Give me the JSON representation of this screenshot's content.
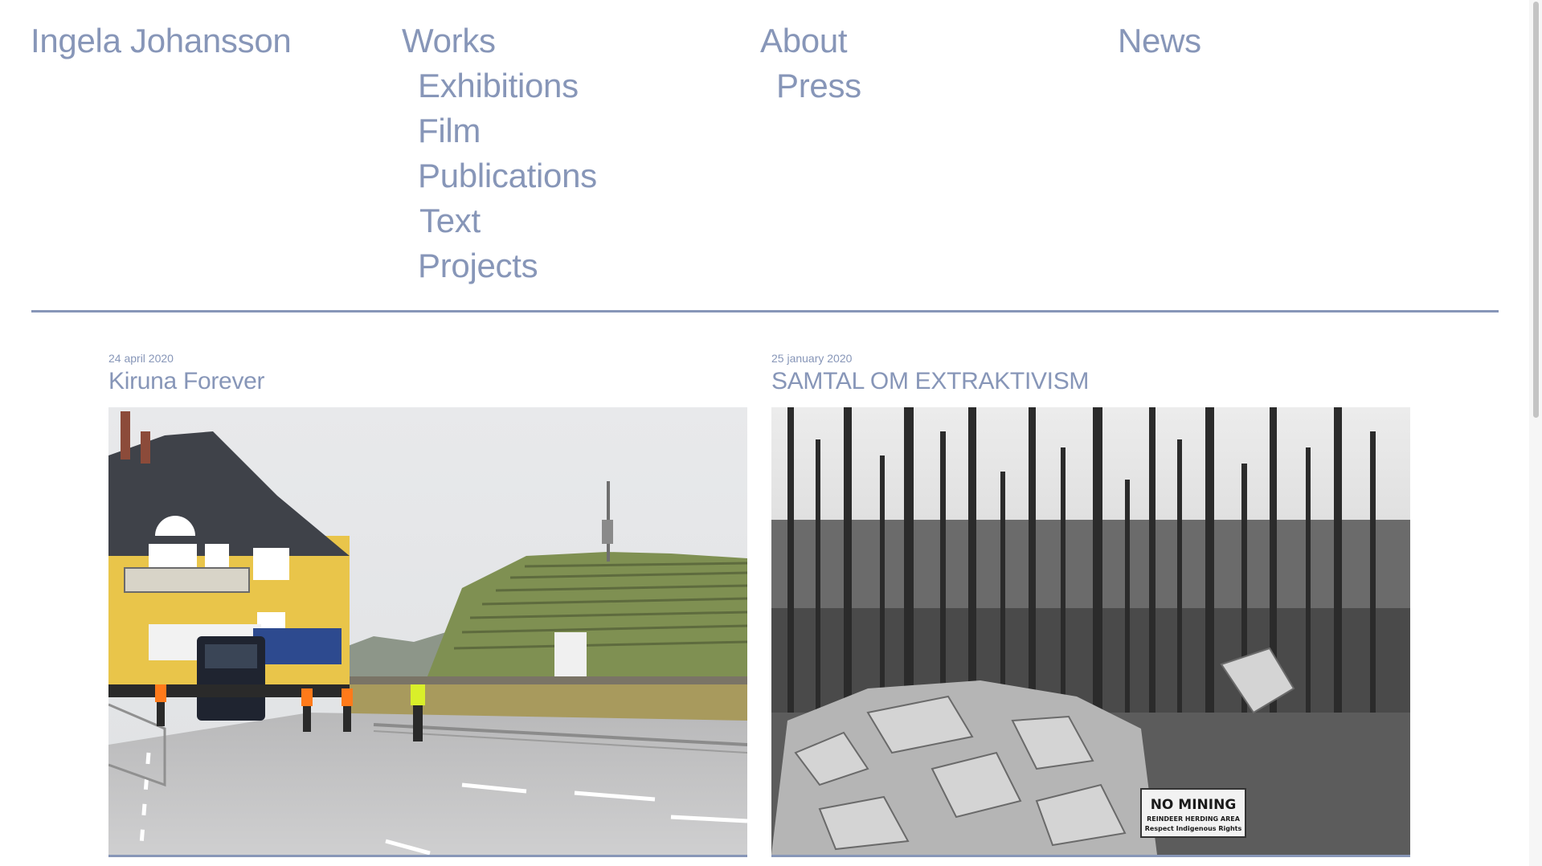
{
  "site": {
    "title": "Ingela Johansson"
  },
  "nav": {
    "works": "Works",
    "about": "About",
    "news": "News",
    "works_sub": [
      "Exhibitions",
      "Film",
      "Publications",
      "Text",
      "Projects"
    ],
    "about_sub": [
      "Press"
    ]
  },
  "theme": {
    "accent": "#8796b8",
    "background": "#ffffff"
  },
  "news": [
    {
      "date": "24 april 2020",
      "title": "Kiruna Forever",
      "image_icon": "photo-house-relocation"
    },
    {
      "date": "25 january 2020",
      "title": "SAMTAL OM EXTRAKTIVISM",
      "image_icon": "photo-forest-no-mining",
      "sign_line1": "NO MINING",
      "sign_line2": "REINDEER HERDING AREA",
      "sign_line3": "Respect Indigenous Rights"
    }
  ]
}
